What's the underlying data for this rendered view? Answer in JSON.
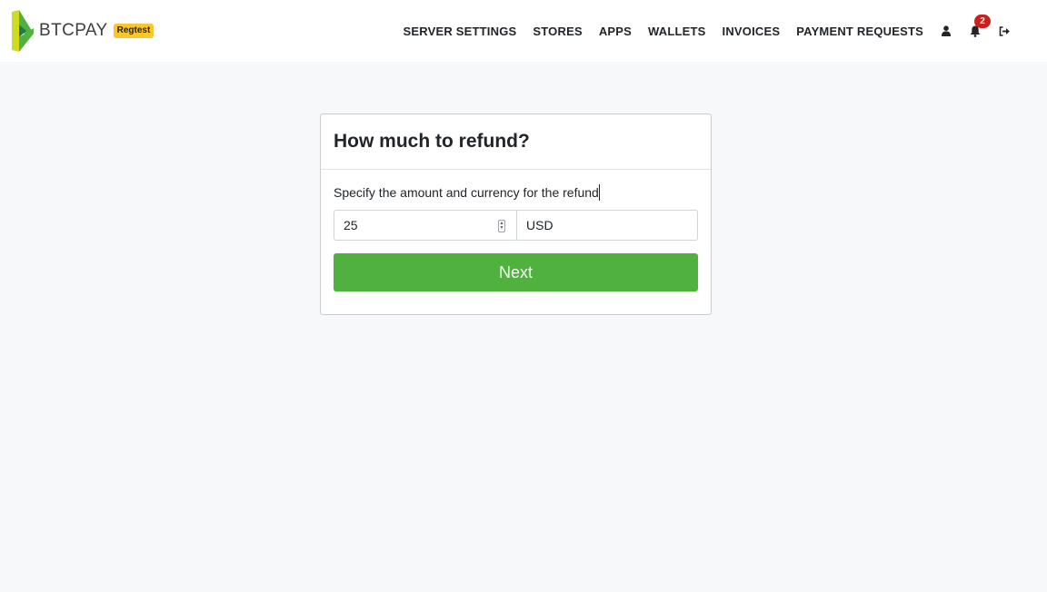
{
  "brand": {
    "name": "BTCPAY",
    "environment": "Regtest",
    "logo_colors": [
      "#cedc21",
      "#51b13e",
      "#1e7a44"
    ]
  },
  "nav": {
    "links": [
      "SERVER SETTINGS",
      "STORES",
      "APPS",
      "WALLETS",
      "INVOICES",
      "PAYMENT REQUESTS"
    ],
    "icons": [
      "user-icon",
      "bell-icon",
      "sign-out-icon"
    ],
    "notification_count": "2"
  },
  "refund": {
    "title": "How much to refund?",
    "description": "Specify the amount and currency for the refund",
    "amount": "25",
    "currency": "USD",
    "next_label": "Next"
  },
  "colors": {
    "accent": "#51b13e",
    "badge": "#c8211e",
    "env_badge": "#fbc52c",
    "background": "#f7f8fa"
  }
}
